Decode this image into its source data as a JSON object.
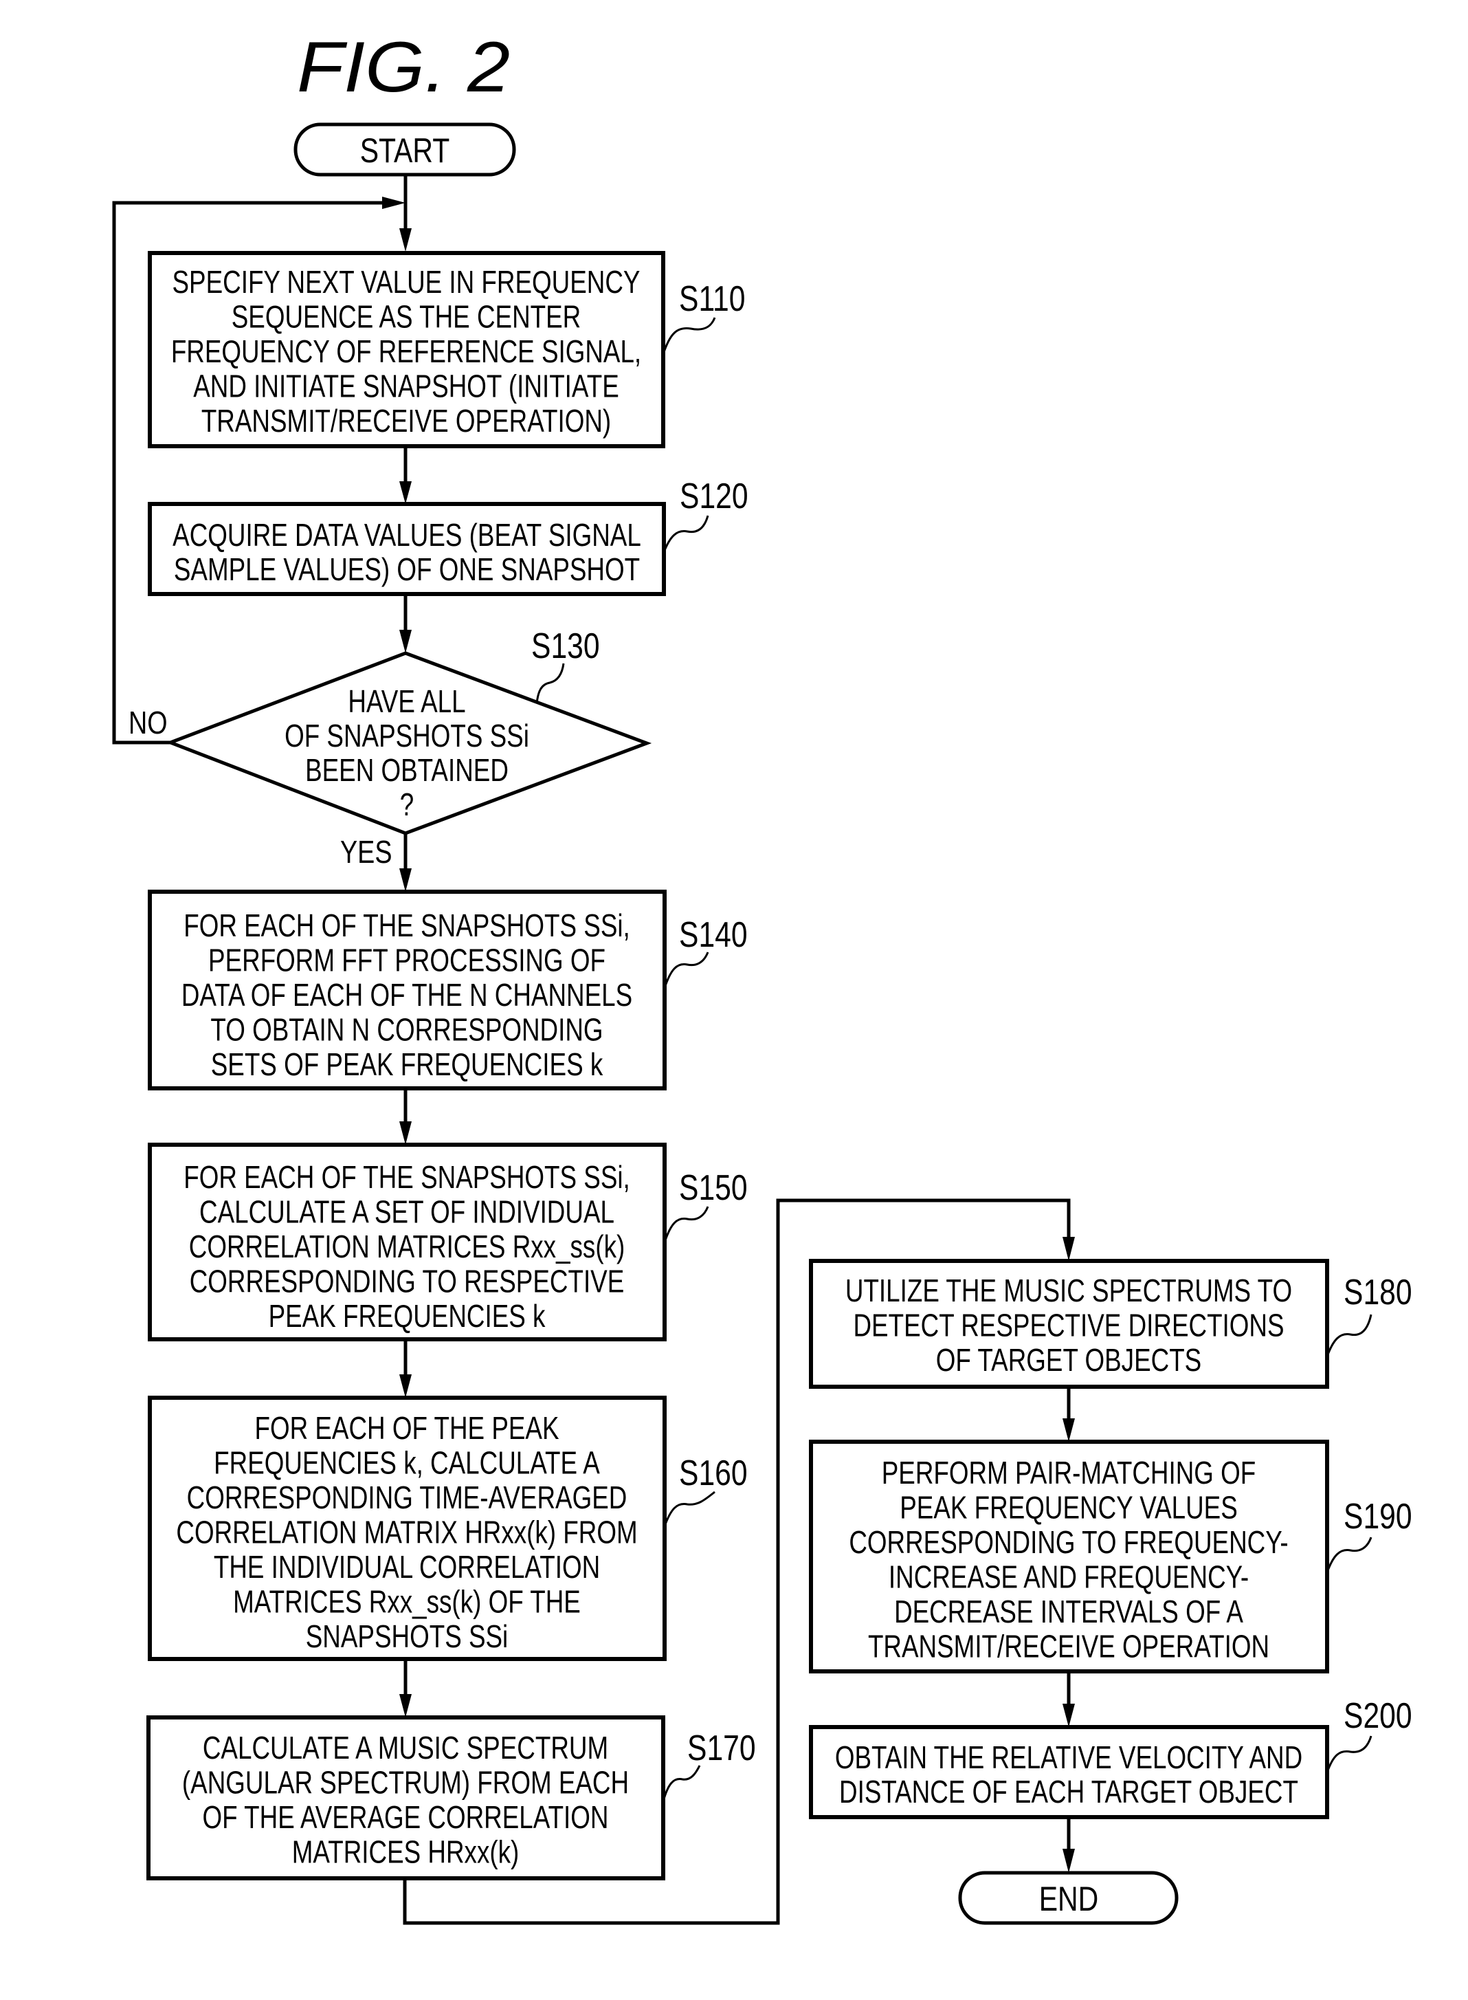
{
  "figure": {
    "title": "FIG.  2"
  },
  "terminals": {
    "start": "START",
    "end": "END"
  },
  "decision_labels": {
    "no": "NO",
    "yes": "YES"
  },
  "steps": {
    "s110": {
      "label": "S110",
      "lines": [
        "SPECIFY NEXT VALUE IN FREQUENCY",
        "SEQUENCE AS THE CENTER",
        "FREQUENCY OF REFERENCE SIGNAL,",
        "AND INITIATE SNAPSHOT (INITIATE",
        "TRANSMIT/RECEIVE OPERATION)"
      ]
    },
    "s120": {
      "label": "S120",
      "lines": [
        "ACQUIRE DATA VALUES (BEAT SIGNAL",
        "SAMPLE VALUES) OF ONE SNAPSHOT"
      ]
    },
    "s130": {
      "label": "S130",
      "lines": [
        "HAVE ALL",
        "OF SNAPSHOTS SSi",
        "BEEN OBTAINED",
        "?"
      ]
    },
    "s140": {
      "label": "S140",
      "lines": [
        "FOR EACH OF THE SNAPSHOTS SSi,",
        "PERFORM FFT PROCESSING OF",
        "DATA OF EACH OF THE N CHANNELS",
        "TO OBTAIN N CORRESPONDING",
        "SETS OF PEAK FREQUENCIES k"
      ]
    },
    "s150": {
      "label": "S150",
      "lines": [
        "FOR EACH OF THE SNAPSHOTS SSi,",
        "CALCULATE A SET OF INDIVIDUAL",
        "CORRELATION MATRICES Rxx_ss(k)",
        "CORRESPONDING TO RESPECTIVE",
        "PEAK FREQUENCIES k"
      ]
    },
    "s160": {
      "label": "S160",
      "lines": [
        "FOR EACH OF THE PEAK",
        "FREQUENCIES k, CALCULATE A",
        "CORRESPONDING TIME-AVERAGED",
        "CORRELATION MATRIX HRxx(k) FROM",
        "THE INDIVIDUAL CORRELATION",
        "MATRICES Rxx_ss(k) OF THE",
        "SNAPSHOTS SSi"
      ]
    },
    "s170": {
      "label": "S170",
      "lines": [
        "CALCULATE A MUSIC SPECTRUM",
        "(ANGULAR SPECTRUM) FROM EACH",
        "OF THE AVERAGE CORRELATION",
        "MATRICES HRxx(k)"
      ]
    },
    "s180": {
      "label": "S180",
      "lines": [
        "UTILIZE THE MUSIC SPECTRUMS TO",
        "DETECT RESPECTIVE DIRECTIONS",
        "OF TARGET OBJECTS"
      ]
    },
    "s190": {
      "label": "S190",
      "lines": [
        "PERFORM PAIR-MATCHING OF",
        "PEAK FREQUENCY VALUES",
        "CORRESPONDING TO FREQUENCY-",
        "INCREASE AND FREQUENCY-",
        "DECREASE INTERVALS OF A",
        "TRANSMIT/RECEIVE OPERATION"
      ]
    },
    "s200": {
      "label": "S200",
      "lines": [
        "OBTAIN THE RELATIVE VELOCITY AND",
        "DISTANCE OF EACH TARGET OBJECT"
      ]
    }
  }
}
